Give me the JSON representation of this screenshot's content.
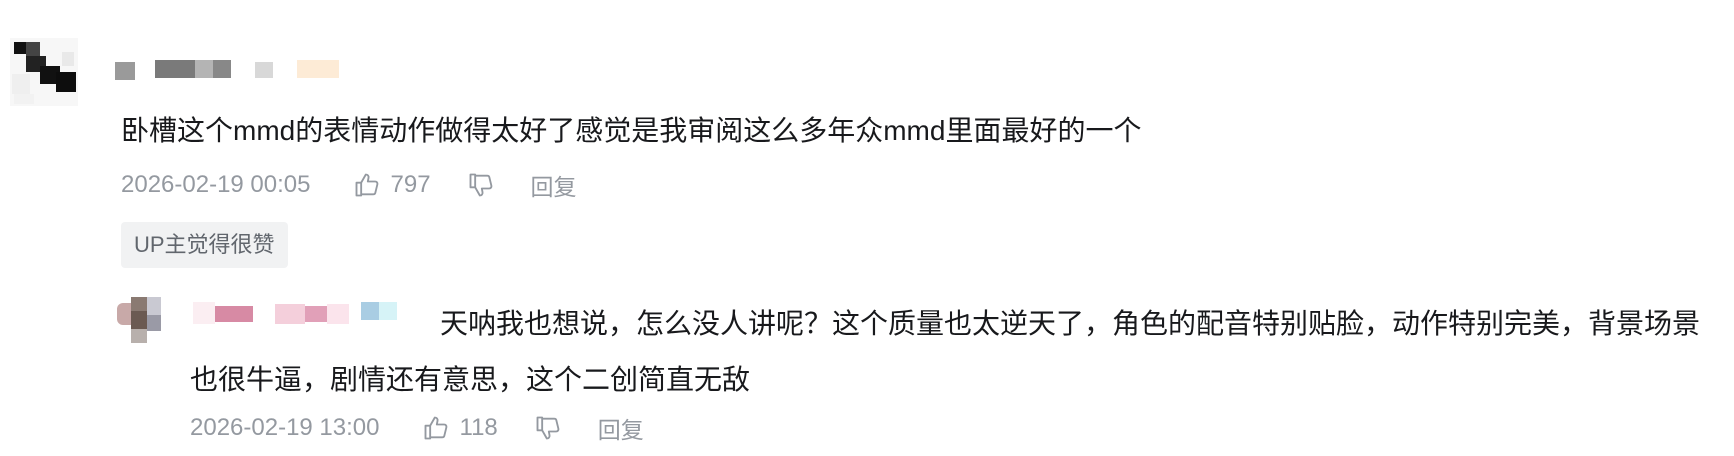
{
  "comment": {
    "content": "卧槽这个mmd的表情动作做得太好了感觉是我审阅这么多年众mmd里面最好的一个",
    "time": "2026-02-19 00:05",
    "likes": "797",
    "reply_label": "回复",
    "badge": "UP主觉得很赞",
    "avatar_icon": "avatar-icon",
    "like_icon": "thumbs-up-icon",
    "dislike_icon": "thumbs-down-icon"
  },
  "reply": {
    "content": "天呐我也想说，怎么没人讲呢？这个质量也太逆天了，角色的配音特别贴脸，动作特别完美，背景场景也很牛逼，剧情还有意思，这个二创简直无敌",
    "time": "2026-02-19 13:00",
    "likes": "118",
    "reply_label": "回复"
  },
  "colors": {
    "text": "#18191c",
    "meta": "#9499a0",
    "badge_bg": "#f1f2f3",
    "badge_text": "#61666d"
  }
}
